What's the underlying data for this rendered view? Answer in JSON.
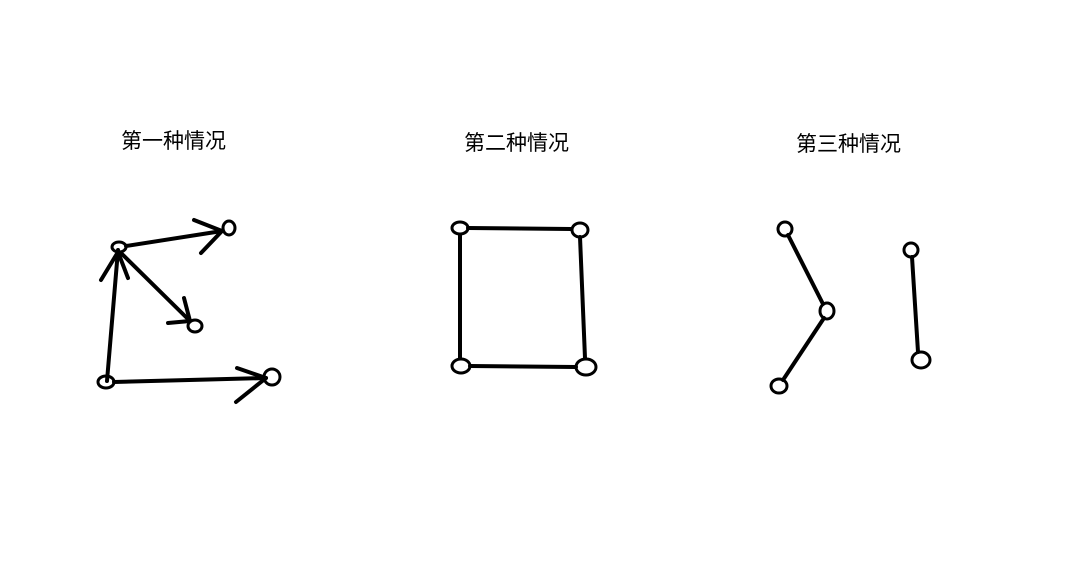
{
  "panels": [
    {
      "title": "第一种情况"
    },
    {
      "title": "第二种情况"
    },
    {
      "title": "第三种情况"
    }
  ],
  "colors": {
    "stroke": "#000000",
    "background": "#ffffff"
  }
}
